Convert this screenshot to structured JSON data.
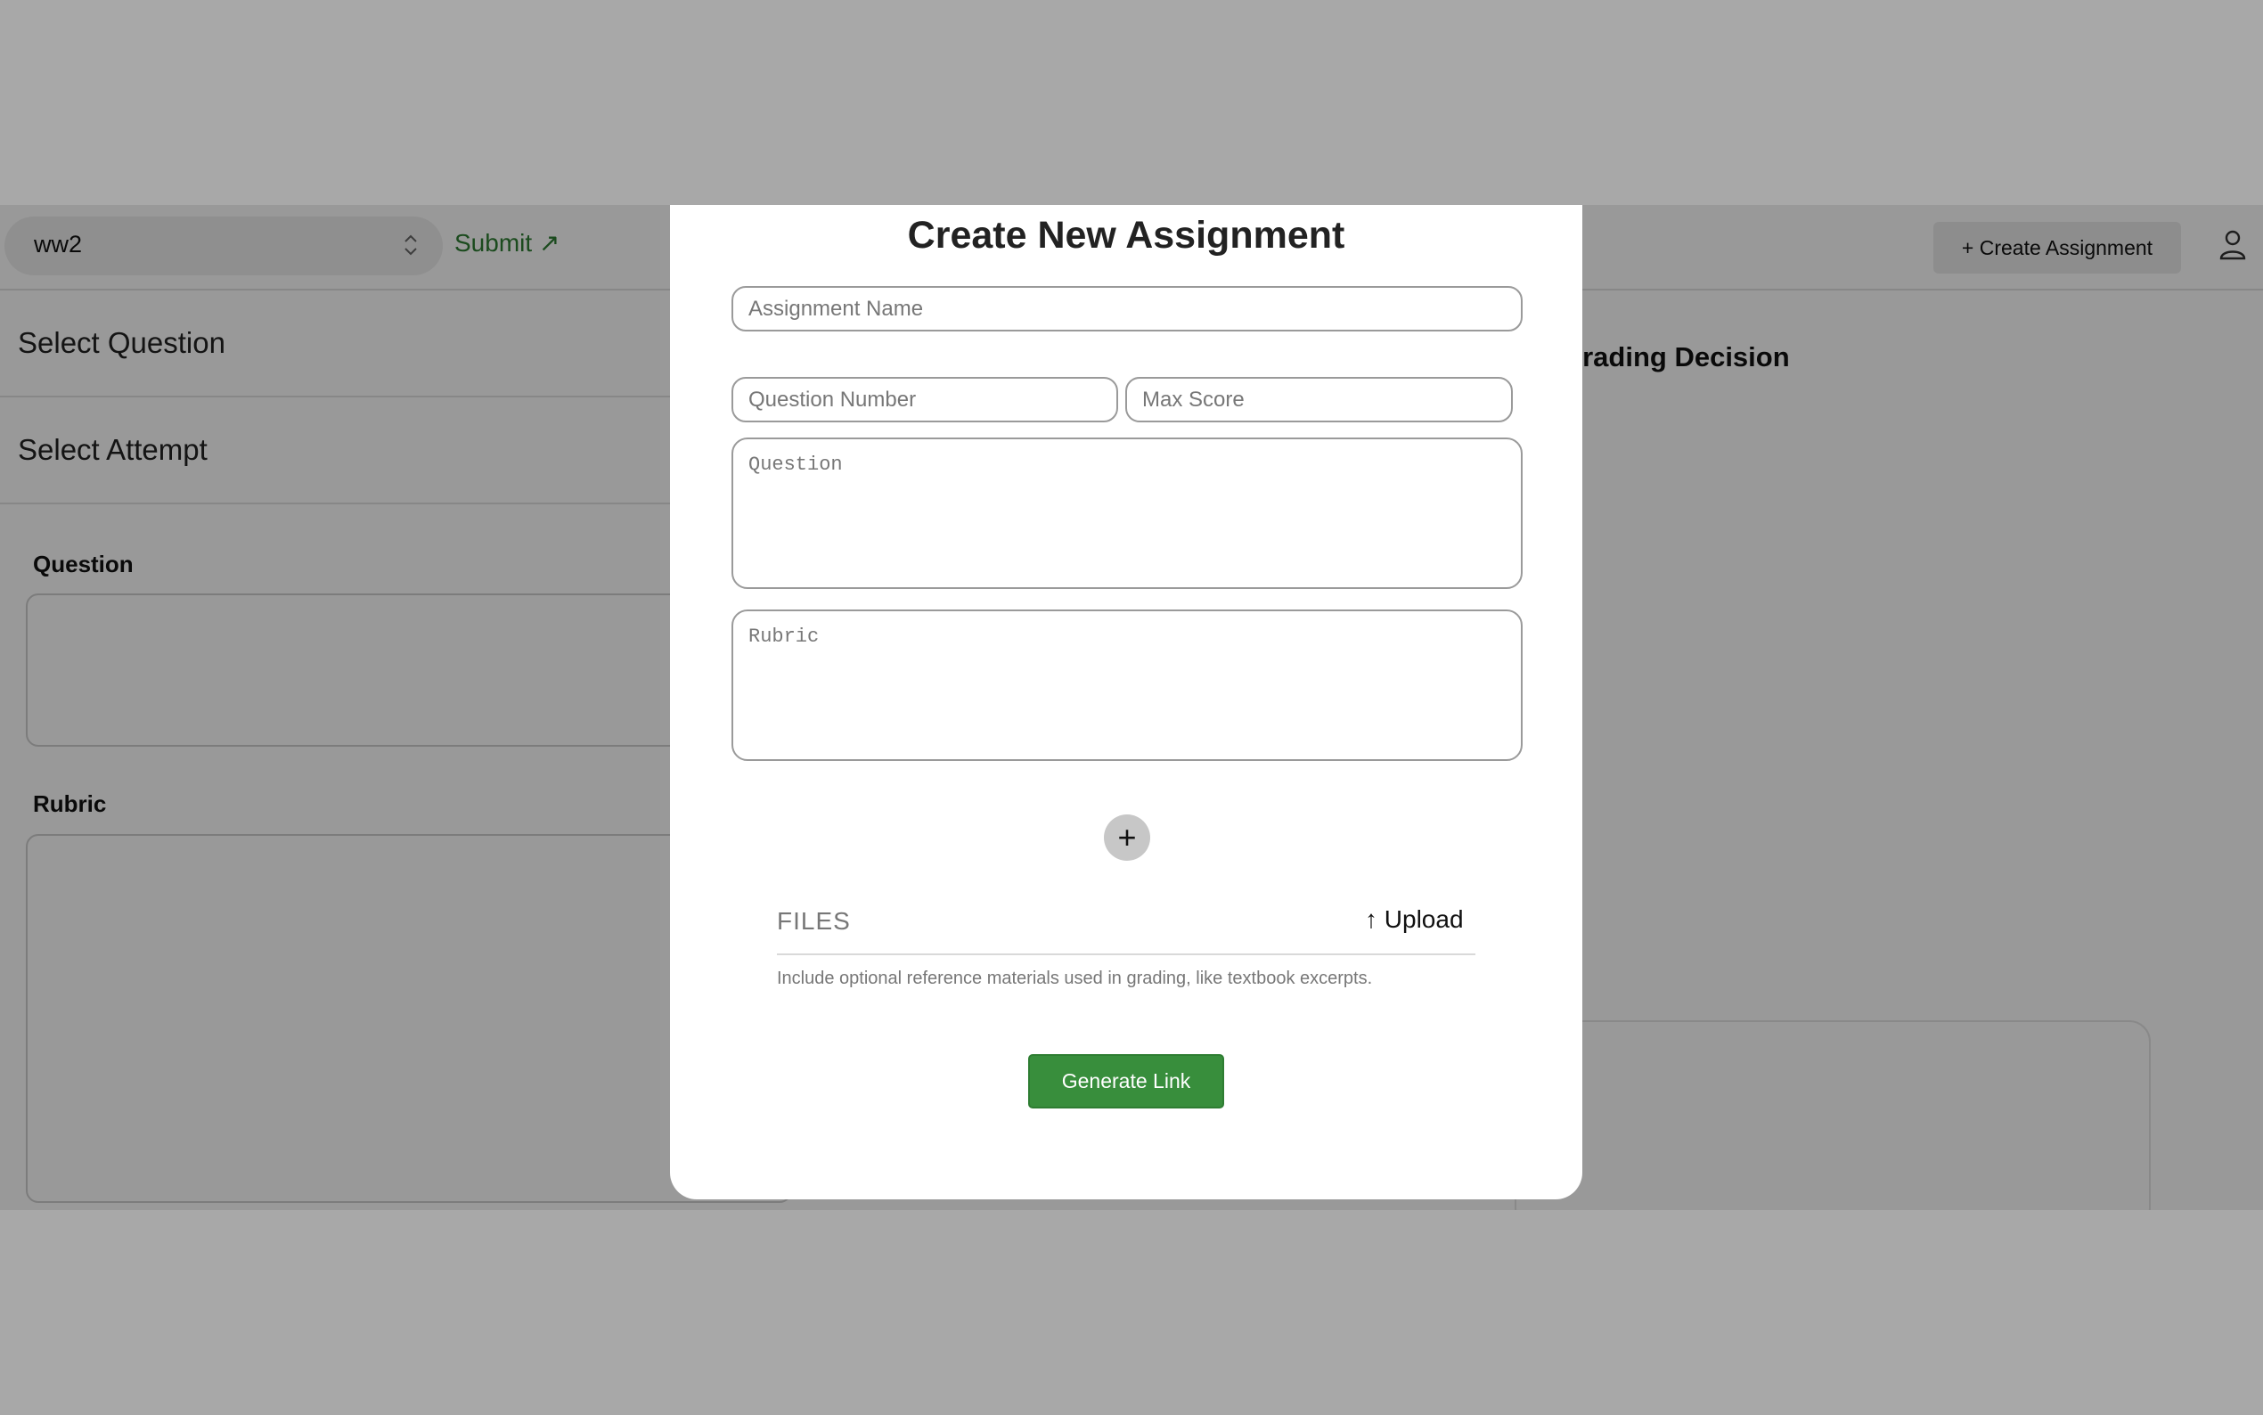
{
  "topbar": {
    "assignment_select_value": "ww2",
    "submit_link": "Submit ↗",
    "create_assignment_button": "+ Create Assignment"
  },
  "left_panel": {
    "select_question": "Select Question",
    "select_attempt": "Select Attempt",
    "question_label": "Question",
    "rubric_label": "Rubric"
  },
  "right_panel": {
    "grading_decision_title": "Grading Decision"
  },
  "modal": {
    "title": "Create New Assignment",
    "assignment_name_placeholder": "Assignment Name",
    "question_number_placeholder": "Question Number",
    "max_score_placeholder": "Max Score",
    "question_placeholder": "Question",
    "rubric_placeholder": "Rubric",
    "add_button": "+",
    "files_label": "FILES",
    "upload_button": "↑ Upload",
    "files_help": "Include optional reference materials used in grading, like textbook excerpts.",
    "generate_button": "Generate Link"
  },
  "colors": {
    "accent_green": "#388e3c",
    "link_green": "#2e7d32"
  }
}
